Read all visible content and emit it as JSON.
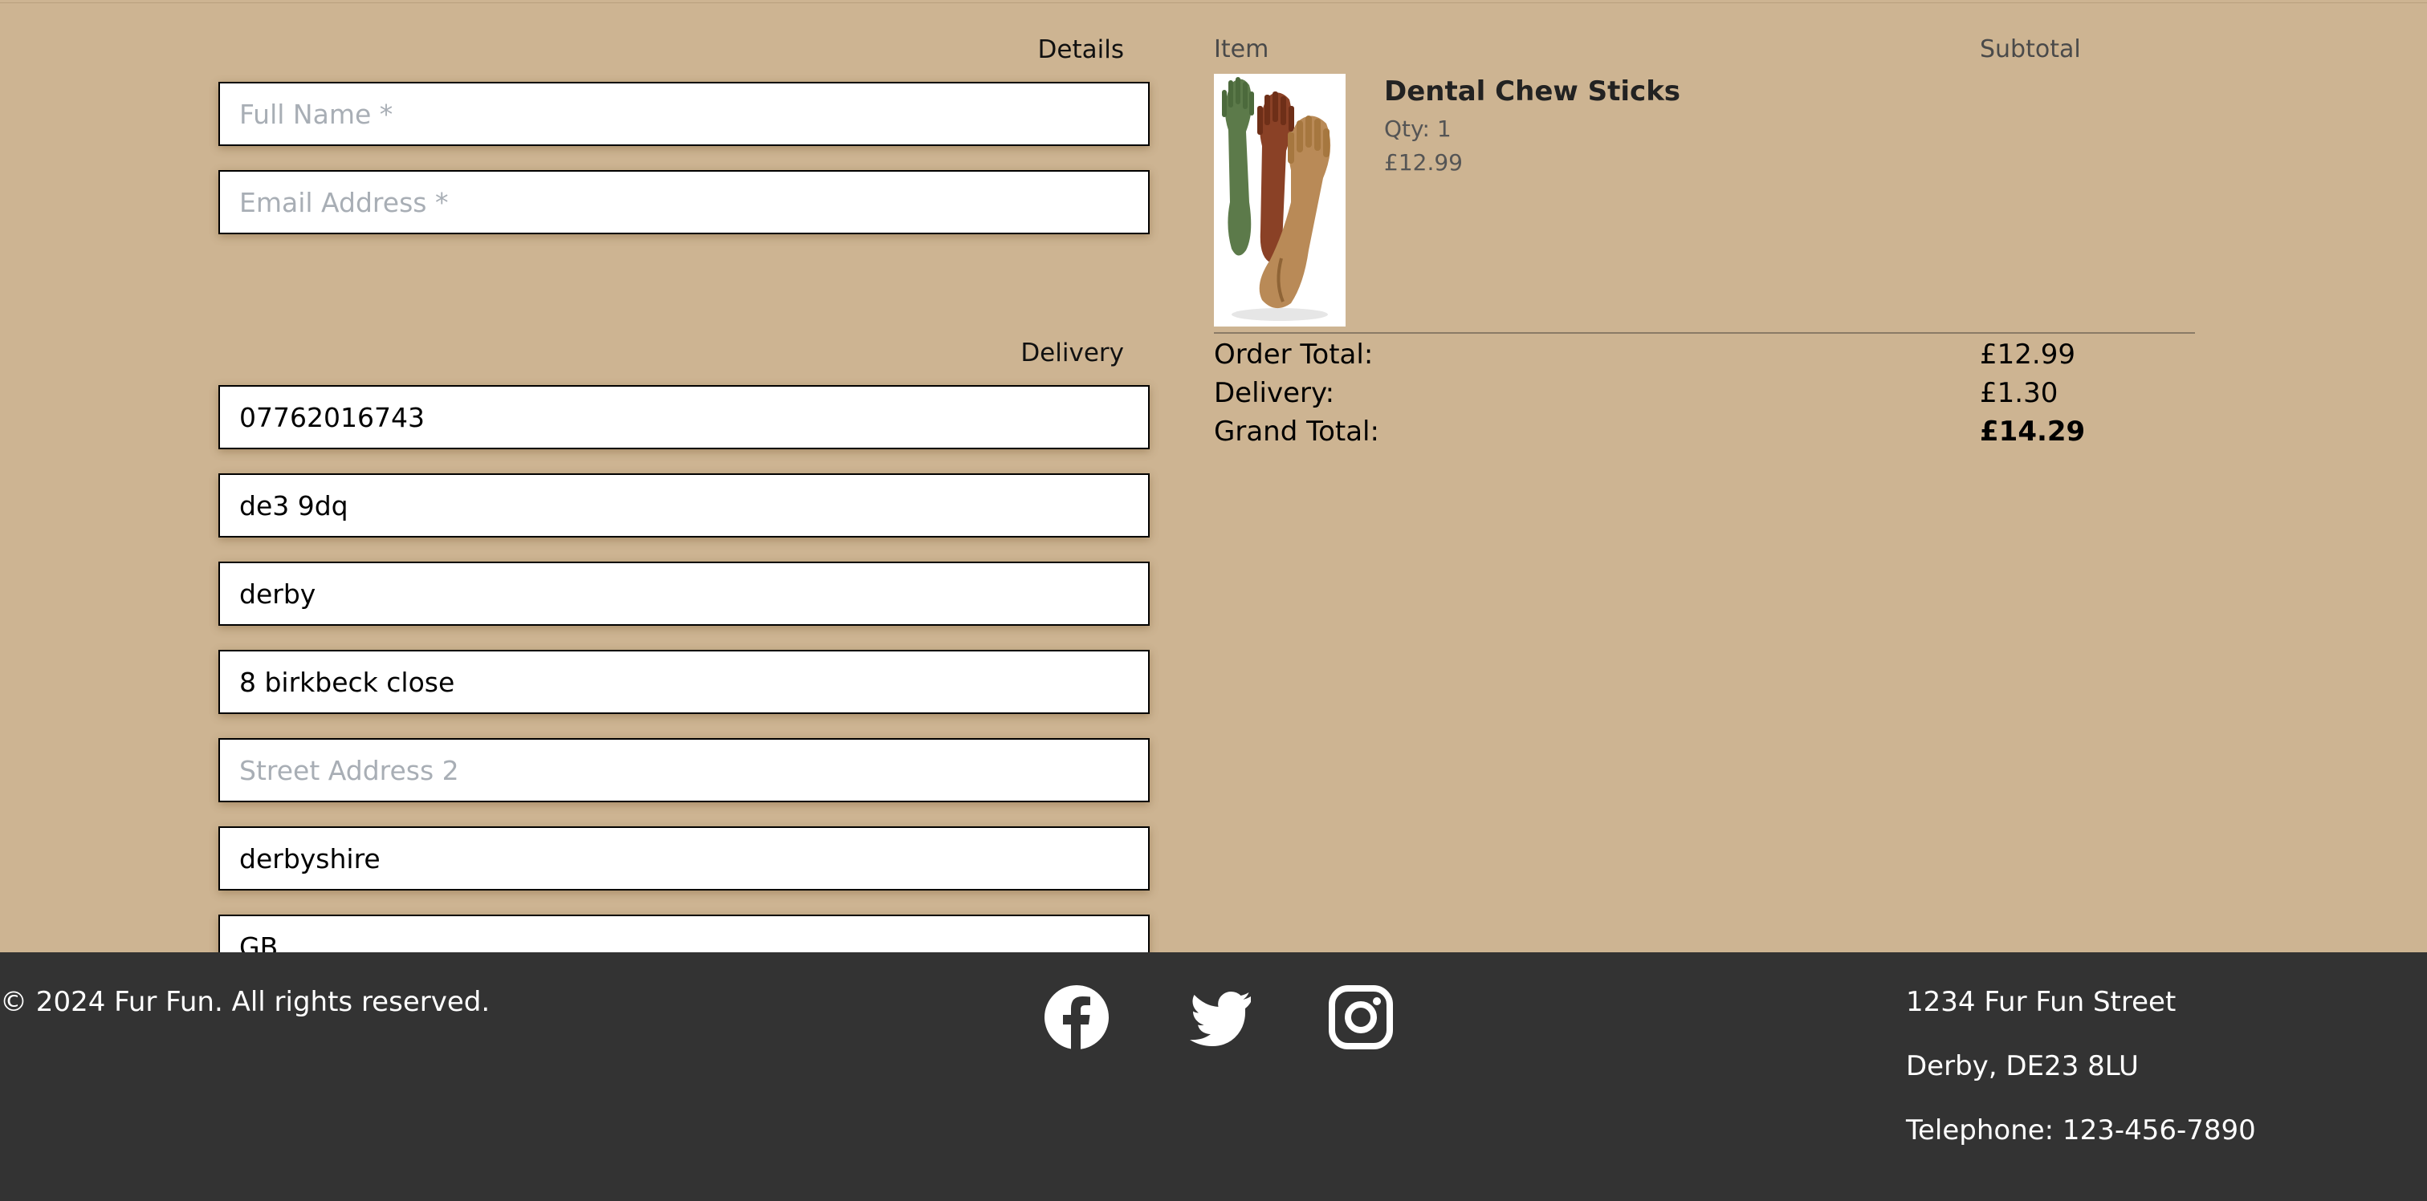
{
  "checkout": {
    "details": {
      "heading": "Details",
      "full_name_placeholder": "Full Name *",
      "email_placeholder": "Email Address *"
    },
    "delivery": {
      "heading": "Delivery",
      "phone_value": "07762016743",
      "postcode_value": "de3 9dq",
      "town_value": "derby",
      "street1_value": "8 birkbeck close",
      "street2_placeholder": "Street Address 2",
      "county_value": "derbyshire",
      "country_value": "GB"
    }
  },
  "summary": {
    "item_header": "Item",
    "subtotal_header": "Subtotal",
    "items": [
      {
        "name": "Dental Chew Sticks",
        "qty": "Qty: 1",
        "price": "£12.99"
      }
    ],
    "order_total_label": "Order Total:",
    "order_total_value": "£12.99",
    "delivery_label": "Delivery:",
    "delivery_value": "£1.30",
    "grand_total_label": "Grand Total:",
    "grand_total_value": "£14.29"
  },
  "footer": {
    "copyright": "© 2024 Fur Fun. All rights reserved.",
    "social": [
      "facebook-icon",
      "twitter-icon",
      "instagram-icon"
    ],
    "address_line1": "1234 Fur Fun Street",
    "address_line2": "Derby, DE23 8LU",
    "telephone": "Telephone: 123-456-7890"
  },
  "colors": {
    "page_bg": "#cdb492",
    "footer_bg": "#333333",
    "placeholder": "#a8aeb5"
  }
}
